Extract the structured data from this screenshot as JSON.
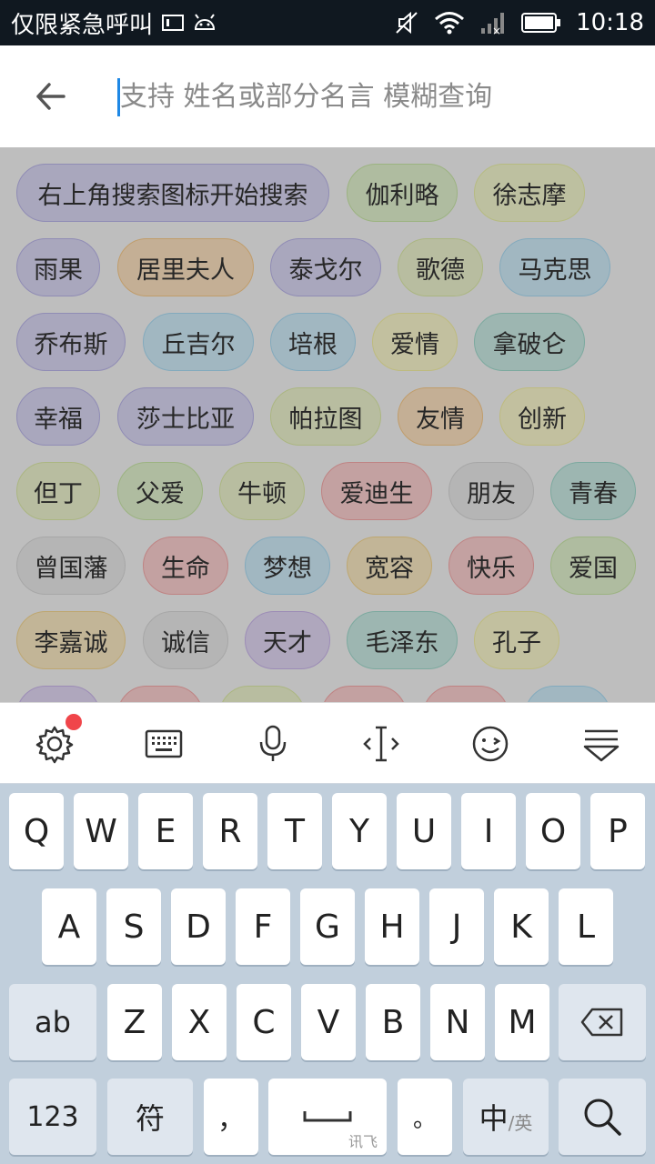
{
  "status_bar": {
    "carrier_text": "仅限紧急呼叫",
    "time": "10:18",
    "icons": [
      "sim-card-icon",
      "android-icon",
      "mute-icon",
      "wifi-icon",
      "signal-icon",
      "battery-icon"
    ]
  },
  "search": {
    "placeholder": "支持 姓名或部分名言 模糊查询",
    "back_icon": "arrow-left-icon"
  },
  "tags": [
    {
      "label": "右上角搜索图标开始搜索",
      "color": "#b9b4e8"
    },
    {
      "label": "伽利略",
      "color": "#c8e6a6"
    },
    {
      "label": "徐志摩",
      "color": "#eaf0a6"
    },
    {
      "label": "雨果",
      "color": "#b9b4e8"
    },
    {
      "label": "居里夫人",
      "color": "#f7c98a"
    },
    {
      "label": "泰戈尔",
      "color": "#b9b4e8"
    },
    {
      "label": "歌德",
      "color": "#dceaa6"
    },
    {
      "label": "马克思",
      "color": "#a8daf2"
    },
    {
      "label": "乔布斯",
      "color": "#b9b4e8"
    },
    {
      "label": "丘吉尔",
      "color": "#a8daf2"
    },
    {
      "label": "培根",
      "color": "#a8daf2"
    },
    {
      "label": "爱情",
      "color": "#f4f0a2"
    },
    {
      "label": "拿破仑",
      "color": "#9fd9cc"
    },
    {
      "label": "幸福",
      "color": "#b9b4e8"
    },
    {
      "label": "莎士比亚",
      "color": "#b9b4e8"
    },
    {
      "label": "帕拉图",
      "color": "#dceaa6"
    },
    {
      "label": "友情",
      "color": "#f7c98a"
    },
    {
      "label": "创新",
      "color": "#f4f0a2"
    },
    {
      "label": "但丁",
      "color": "#dceaa6"
    },
    {
      "label": "父爱",
      "color": "#c8e6a6"
    },
    {
      "label": "牛顿",
      "color": "#dceaa6"
    },
    {
      "label": "爱迪生",
      "color": "#f5a8a8"
    },
    {
      "label": "朋友",
      "color": "#d6d6d6"
    },
    {
      "label": "青春",
      "color": "#9fd9cc"
    },
    {
      "label": "曾国藩",
      "color": "#d6d6d6"
    },
    {
      "label": "生命",
      "color": "#f5a8a8"
    },
    {
      "label": "梦想",
      "color": "#a8daf2"
    },
    {
      "label": "宽容",
      "color": "#f4d690"
    },
    {
      "label": "快乐",
      "color": "#f5a8a8"
    },
    {
      "label": "爱国",
      "color": "#c8e6a6"
    },
    {
      "label": "李嘉诚",
      "color": "#f4d690"
    },
    {
      "label": "诚信",
      "color": "#d6d6d6"
    },
    {
      "label": "天才",
      "color": "#c8b4ea"
    },
    {
      "label": "毛泽东",
      "color": "#9fd9cc"
    },
    {
      "label": "孔子",
      "color": "#f4f0a2"
    },
    {
      "label": "",
      "color": "#c8b4ea"
    },
    {
      "label": "",
      "color": "#f5a8a8"
    },
    {
      "label": "",
      "color": "#dceaa6"
    },
    {
      "label": "",
      "color": "#f5a8a8"
    },
    {
      "label": "",
      "color": "#f5a8a8"
    },
    {
      "label": "",
      "color": "#a8daf2"
    }
  ],
  "keyboard_toolbar": {
    "items": [
      "settings-icon",
      "keyboard-icon",
      "microphone-icon",
      "text-cursor-icon",
      "emoji-icon",
      "collapse-keyboard-icon"
    ]
  },
  "keyboard": {
    "row1": [
      "Q",
      "W",
      "E",
      "R",
      "T",
      "Y",
      "U",
      "I",
      "O",
      "P"
    ],
    "row2": [
      "A",
      "S",
      "D",
      "F",
      "G",
      "H",
      "J",
      "K",
      "L"
    ],
    "row3": [
      "Z",
      "X",
      "C",
      "V",
      "B",
      "N",
      "M"
    ],
    "ab_key": "ab",
    "num_key": "123",
    "symbol_key": "符",
    "comma_key": "，",
    "space_sub": "讯飞",
    "period_key": "。",
    "lang_key_main": "中",
    "lang_key_sub": "/英"
  }
}
